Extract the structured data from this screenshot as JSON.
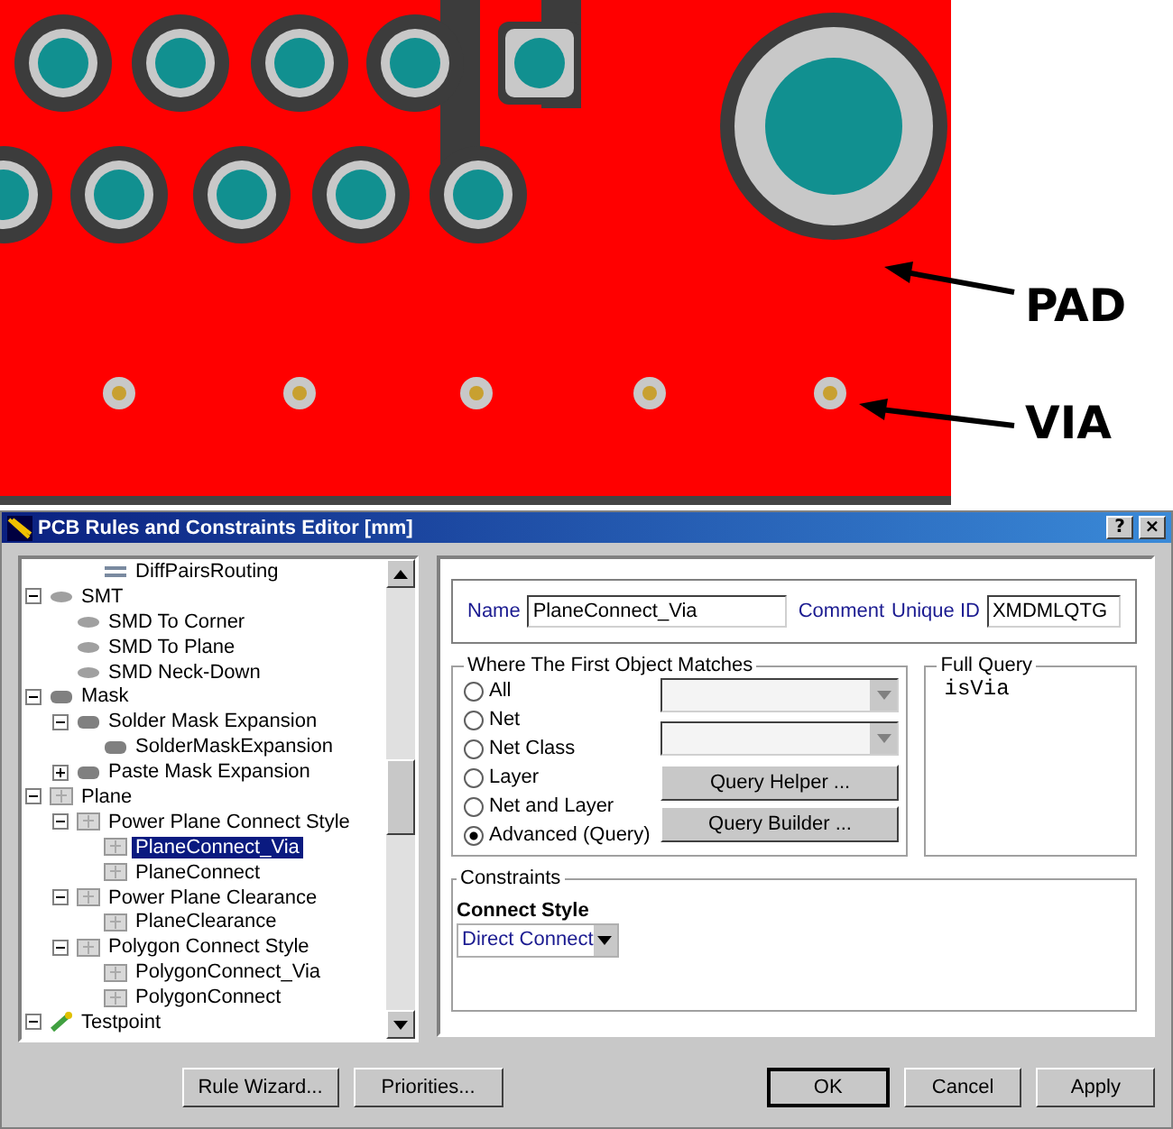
{
  "annotations": [
    {
      "label": "PAD"
    },
    {
      "label": "VIA"
    }
  ],
  "window": {
    "title": "PCB Rules and Constraints Editor [mm]",
    "help_button": "?",
    "close_button": "×"
  },
  "tree": [
    {
      "children": [
        {
          "children": [
            {
              "label": "DiffPairsRouting",
              "kind": "routing",
              "selected": false
            }
          ]
        }
      ]
    },
    {
      "label": "SMT",
      "kind": "smt",
      "expanded": true,
      "selected": false,
      "children": [
        {
          "label": "SMD To Corner",
          "kind": "smt",
          "selected": false
        },
        {
          "label": "SMD To Plane",
          "kind": "smt",
          "selected": false
        },
        {
          "label": "SMD Neck-Down",
          "kind": "smt",
          "selected": false
        }
      ]
    },
    {
      "label": "Mask",
      "kind": "mask",
      "expanded": true,
      "selected": false,
      "children": [
        {
          "label": "Solder Mask Expansion",
          "kind": "mask",
          "expanded": true,
          "selected": false,
          "children": [
            {
              "label": "SolderMaskExpansion",
              "kind": "mask",
              "selected": false
            }
          ]
        },
        {
          "label": "Paste Mask Expansion",
          "kind": "mask",
          "expanded": false,
          "selected": false
        }
      ]
    },
    {
      "label": "Plane",
      "kind": "plane",
      "expanded": true,
      "selected": false,
      "children": [
        {
          "label": "Power Plane Connect Style",
          "kind": "plane",
          "expanded": true,
          "selected": false,
          "children": [
            {
              "label": "PlaneConnect_Via",
              "kind": "plane",
              "selected": true
            },
            {
              "label": "PlaneConnect",
              "kind": "plane",
              "selected": false
            }
          ]
        },
        {
          "label": "Power Plane Clearance",
          "kind": "plane",
          "expanded": true,
          "selected": false,
          "children": [
            {
              "label": "PlaneClearance",
              "kind": "plane",
              "selected": false
            }
          ]
        },
        {
          "label": "Polygon Connect Style",
          "kind": "plane",
          "expanded": true,
          "selected": false,
          "children": [
            {
              "label": "PolygonConnect_Via",
              "kind": "plane",
              "selected": false
            },
            {
              "label": "PolygonConnect",
              "kind": "plane",
              "selected": false
            }
          ]
        }
      ]
    },
    {
      "label": "Testpoint",
      "kind": "testpoint",
      "expanded": true,
      "selected": false
    }
  ],
  "rule": {
    "name_label": "Name",
    "name_value": "PlaneConnect_Via",
    "comment_label": "Comment",
    "unique_id_label": "Unique ID",
    "unique_id_value": "XMDMLQTG"
  },
  "first_object": {
    "title": "Where The First Object Matches",
    "options": [
      {
        "label": "All",
        "selected": false
      },
      {
        "label": "Net",
        "selected": false
      },
      {
        "label": "Net Class",
        "selected": false
      },
      {
        "label": "Layer",
        "selected": false
      },
      {
        "label": "Net and Layer",
        "selected": false
      },
      {
        "label": "Advanced (Query)",
        "selected": true
      }
    ],
    "dropdowns": [
      {
        "disabled": true
      },
      {
        "disabled": true
      }
    ],
    "buttons": [
      "Query Helper ...",
      "Query Builder ..."
    ]
  },
  "full_query": {
    "title": "Full Query",
    "text": "isVia"
  },
  "constraints": {
    "title": "Constraints",
    "field_label": "Connect Style",
    "value": "Direct Connect"
  },
  "footer_buttons": [
    {
      "label": "Rule Wizard...",
      "default": false
    },
    {
      "label": "Priorities...",
      "default": false
    },
    {
      "label": "OK",
      "default": true
    },
    {
      "label": "Cancel",
      "default": false
    },
    {
      "label": "Apply",
      "default": false
    }
  ]
}
